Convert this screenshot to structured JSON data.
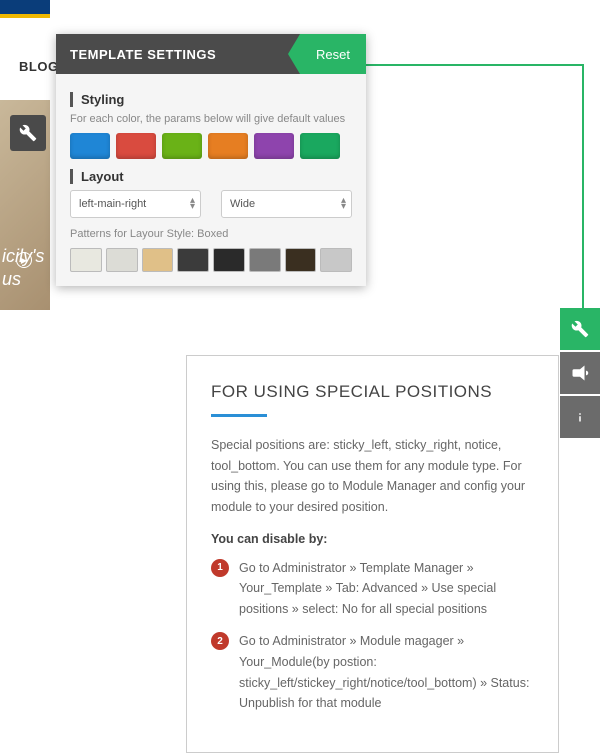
{
  "nav": {
    "blog": "BLOG"
  },
  "bg_text": "icily's \nus",
  "panel": {
    "title": "TEMPLATE SETTINGS",
    "reset": "Reset",
    "styling_label": "Styling",
    "styling_hint": "For each color, the params below will give default values",
    "colors": [
      "#1f86d6",
      "#d94b3f",
      "#6ab217",
      "#e67e22",
      "#8e44ad",
      "#1aa85f"
    ],
    "layout_label": "Layout",
    "layout_value": "left-main-right",
    "width_value": "Wide",
    "patterns_label": "Patterns for Layour Style: Boxed",
    "patterns": [
      "#e8e8e0",
      "#dcdcd6",
      "#e0c088",
      "#3b3b3b",
      "#2a2a2a",
      "#7a7a7a",
      "#3a2f20",
      "#c8c8c8"
    ]
  },
  "info": {
    "title": "FOR USING SPECIAL POSITIONS",
    "paragraph": "Special positions are: sticky_left, sticky_right, notice, tool_bottom. You can use them for any module type. For using this, please go to Module Manager and config your module to your desired position.",
    "disable_label": "You can disable by:",
    "steps": [
      "Go to Administrator » Template Manager » Your_Template » Tab: Advanced » Use special positions » select: No for all special positions",
      "Go to Administrator » Module magager » Your_Module(by postion: sticky_left/stickey_right/notice/tool_bottom) » Status: Unpublish for that module"
    ]
  }
}
